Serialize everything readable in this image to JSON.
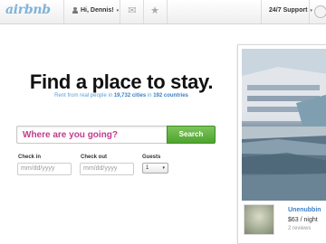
{
  "brand": {
    "logo_text": "airbnb"
  },
  "topbar": {
    "user_label": "Hi, Dennis!",
    "support_label": "24/7 Support",
    "caret": "▾",
    "mail_icon": "envelope-icon",
    "star_icon": "star-icon"
  },
  "hero": {
    "headline": "Find a place to stay.",
    "sub_prefix": "Rent from real people in ",
    "cities_count": "19,732 cities",
    "sub_middle": " in ",
    "countries_count": "192 countries"
  },
  "search": {
    "placeholder": "Where are you going?",
    "button_label": "Search"
  },
  "dates": {
    "checkin_label": "Check in",
    "checkin_placeholder": "mm/dd/yyyy",
    "checkout_label": "Check out",
    "checkout_placeholder": "mm/dd/yyyy",
    "guests_label": "Guests",
    "guests_value": "1"
  },
  "featured": {
    "title": "Unenubbin",
    "price": "$63 / night",
    "reviews": "2 reviews"
  },
  "colors": {
    "logo": "#7fb3d8",
    "link": "#3b7fc4",
    "search_text": "#c23a8e",
    "search_button": "#4ea32e"
  }
}
